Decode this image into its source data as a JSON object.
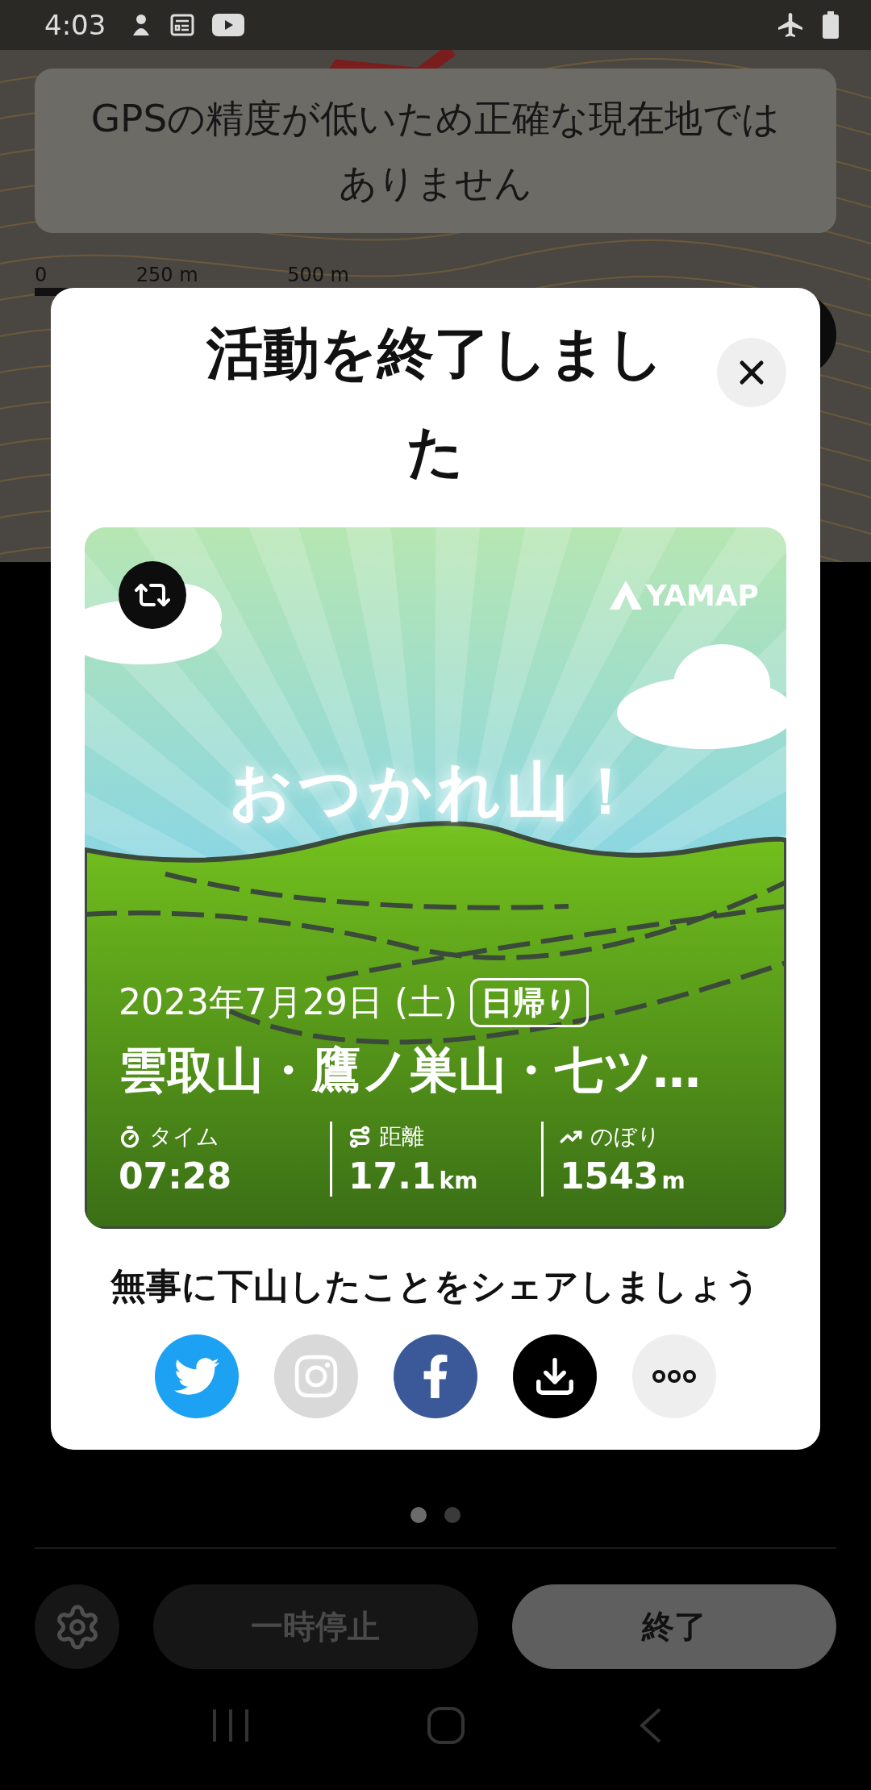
{
  "status_bar": {
    "time": "4:03"
  },
  "toast": {
    "text": "GPSの精度が低いため正確な現在地ではありません"
  },
  "scale_bar": {
    "labels": [
      "0",
      "250 m",
      "500 m"
    ]
  },
  "dialog": {
    "title": "活動を終了しました",
    "card": {
      "headline": "おつかれ山！",
      "brand": "YAMAP",
      "date": "2023年7月29日 (土)",
      "tag": "日帰り",
      "mountains": "雲取山・鷹ノ巣山・七ツ…",
      "stats": [
        {
          "kind": "time",
          "label": "タイム",
          "value": "07:28"
        },
        {
          "kind": "distance",
          "label": "距離",
          "value": "17.1",
          "unit": "km"
        },
        {
          "kind": "ascent",
          "label": "のぼり",
          "value": "1543",
          "unit": "m"
        }
      ]
    },
    "share_prompt": "無事に下山したことをシェアしましょう",
    "share_buttons": [
      {
        "kind": "twitter"
      },
      {
        "kind": "instagram"
      },
      {
        "kind": "facebook"
      },
      {
        "kind": "download"
      },
      {
        "kind": "more"
      }
    ]
  },
  "pager": [
    {
      "selected": true
    },
    {
      "selected": false
    }
  ],
  "actions": [
    {
      "kind": "settings"
    },
    {
      "kind": "pause",
      "label": "一時停止"
    },
    {
      "kind": "end",
      "label": "終了"
    }
  ]
}
